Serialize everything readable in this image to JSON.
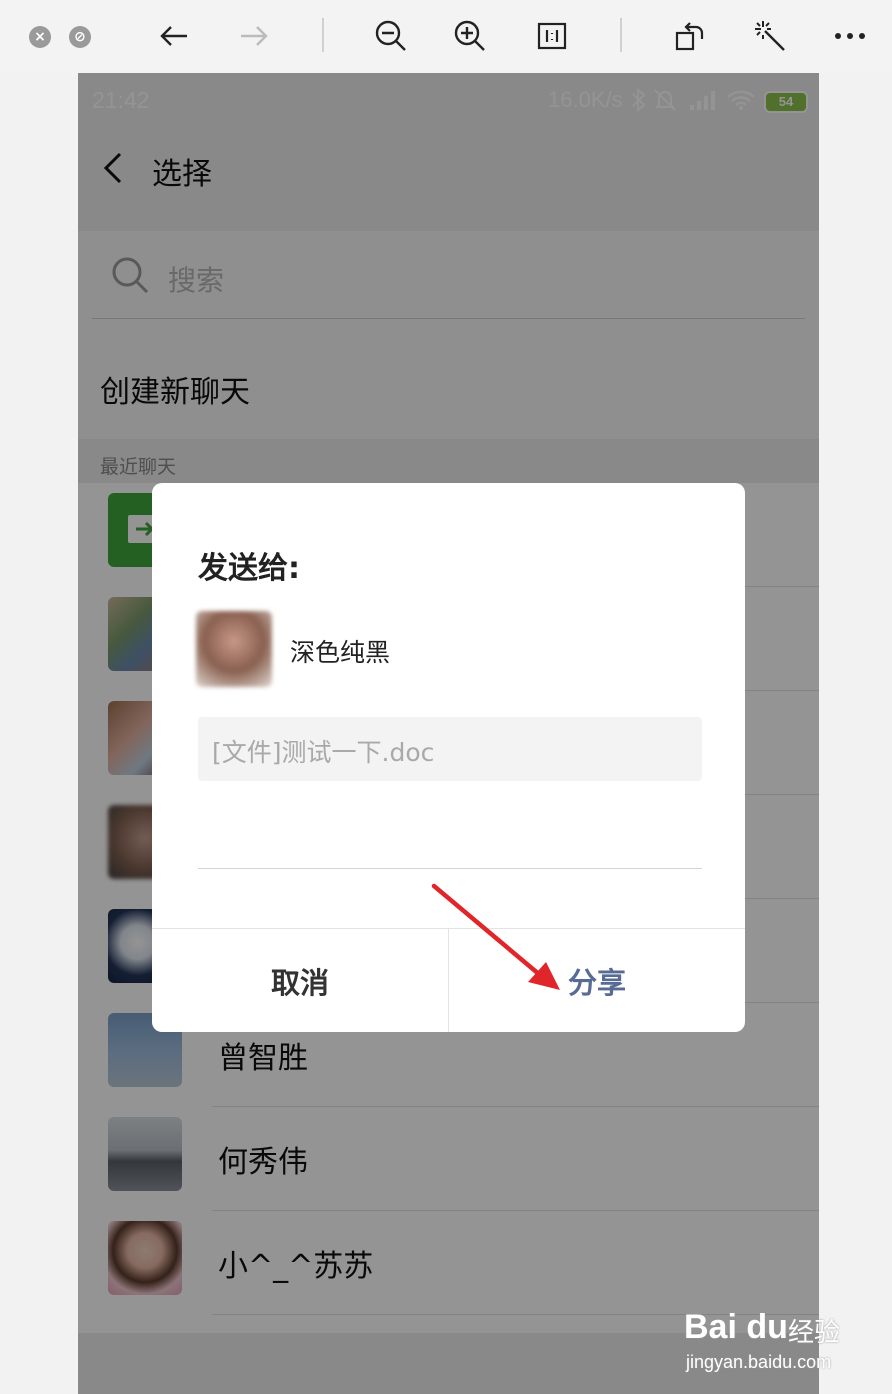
{
  "viewer": {
    "icons": [
      "close-icon",
      "stop-icon",
      "back-arrow-icon",
      "forward-arrow-icon",
      "zoom-out-icon",
      "zoom-in-icon",
      "actual-size-icon",
      "rotate-icon",
      "magic-wand-icon",
      "more-icon"
    ]
  },
  "status_bar": {
    "time": "21:42",
    "network": "16.0K/s",
    "battery": "54"
  },
  "app_bar": {
    "title": "选择"
  },
  "search": {
    "placeholder": "搜索"
  },
  "new_chat": {
    "label": "创建新聊天"
  },
  "recent": {
    "section_label": "最近聊天",
    "contacts": [
      {
        "name": "",
        "avatar": "file-transfer-icon"
      },
      {
        "name": "",
        "avatar": "group-avatar"
      },
      {
        "name": "",
        "avatar": "group-avatar"
      },
      {
        "name": "",
        "avatar": "person-avatar"
      },
      {
        "name": "",
        "avatar": "moon-avatar"
      },
      {
        "name": "曾智胜",
        "avatar": "sky-avatar"
      },
      {
        "name": "何秀伟",
        "avatar": "lake-avatar"
      },
      {
        "name": "小^_^苏苏",
        "avatar": "child-avatar"
      }
    ]
  },
  "dialog": {
    "title": "发送给:",
    "recipient": "深色纯黑",
    "file": "[文件]测试一下.doc",
    "cancel": "取消",
    "share": "分享"
  },
  "watermark": {
    "logo": "Bai du",
    "brand": "经验",
    "url": "jingyan.baidu.com"
  },
  "colors": {
    "share_text": "#576b95",
    "arrow": "#e0252b",
    "file_transfer": "#3fa63a"
  }
}
